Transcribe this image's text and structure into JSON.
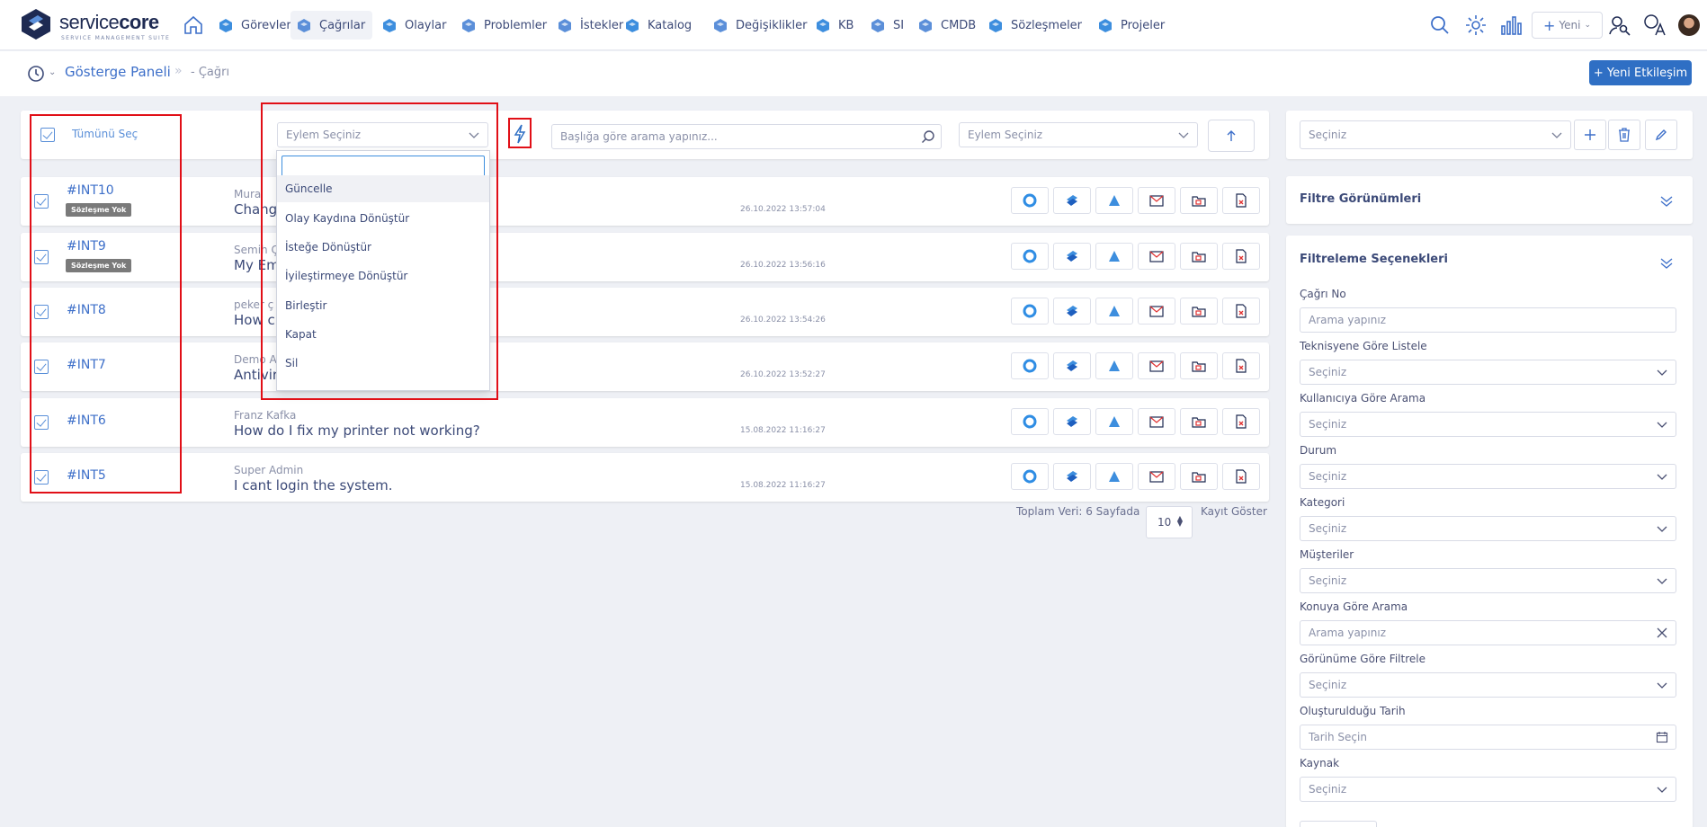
{
  "brand": {
    "name_light": "service",
    "name_bold": "core",
    "tagline": "SERVICE MANAGEMENT SUITE"
  },
  "nav": [
    {
      "label": "Görevler",
      "icon": "tasks-icon"
    },
    {
      "label": "Çağrılar",
      "icon": "calls-icon",
      "active": true
    },
    {
      "label": "Olaylar",
      "icon": "incidents-icon"
    },
    {
      "label": "Problemler",
      "icon": "problems-icon"
    },
    {
      "label": "İstekler",
      "icon": "requests-icon"
    },
    {
      "label": "Katalog",
      "icon": "catalog-icon"
    },
    {
      "label": "Değişiklikler",
      "icon": "changes-icon"
    },
    {
      "label": "KB",
      "icon": "kb-icon"
    },
    {
      "label": "SI",
      "icon": "si-icon"
    },
    {
      "label": "CMDB",
      "icon": "cmdb-icon"
    },
    {
      "label": "Sözleşmeler",
      "icon": "contracts-icon"
    },
    {
      "label": "Projeler",
      "icon": "projects-icon"
    }
  ],
  "topright": {
    "new_label": "Yeni"
  },
  "breadcrumb": {
    "home": "Gösterge Paneli",
    "current": "Çağrı",
    "new_button": "Yeni Etkileşim"
  },
  "toolbar": {
    "select_all": "Tümünü Seç",
    "action_select": "Eylem Seçiniz",
    "search_placeholder": "Başlığa göre arama yapınız...",
    "action_select_2": "Eylem Seçiniz"
  },
  "dropdown": {
    "options": [
      "Güncelle",
      "Olay Kaydına Dönüştür",
      "İsteğe Dönüştür",
      "İyileştirmeye Dönüştür",
      "Birleştir",
      "Kapat",
      "Sil"
    ]
  },
  "rows": [
    {
      "id": "#INT10",
      "badge": "Sözleşme Yok",
      "who": "Mura",
      "title": "Chang",
      "date": "26.10.2022 13:57:04"
    },
    {
      "id": "#INT9",
      "badge": "Sözleşme Yok",
      "who": "Semih Ç",
      "title": "My Em",
      "date": "26.10.2022 13:56:16"
    },
    {
      "id": "#INT8",
      "badge": "",
      "who": "peker ç",
      "title": "How c",
      "date": "26.10.2022 13:54:26"
    },
    {
      "id": "#INT7",
      "badge": "",
      "who": "Demo A",
      "title": "Antivir",
      "date": "26.10.2022 13:52:27"
    },
    {
      "id": "#INT6",
      "badge": "",
      "who": "Franz Kafka",
      "title": "How do I fix my printer not working?",
      "date": "15.08.2022 11:16:27"
    },
    {
      "id": "#INT5",
      "badge": "",
      "who": "Super Admin",
      "title": "I cant login the system.",
      "date": "15.08.2022 11:16:27"
    }
  ],
  "pager": {
    "total": "Toplam Veri: 6 Sayfada",
    "per_page": "10",
    "show": "Kayıt Göster"
  },
  "right_panel": {
    "view_select": "Seçiniz",
    "filter_views": "Filtre Görünümleri",
    "filter_options": "Filtreleme Seçenekleri",
    "fields": [
      {
        "label": "Çağrı No",
        "value": "Arama yapınız",
        "kind": "text"
      },
      {
        "label": "Teknisyene Göre Listele",
        "value": "Seçiniz",
        "kind": "select"
      },
      {
        "label": "Kullanıcıya Göre Arama",
        "value": "Seçiniz",
        "kind": "select"
      },
      {
        "label": "Durum",
        "value": "Seçiniz",
        "kind": "select"
      },
      {
        "label": "Kategori",
        "value": "Seçiniz",
        "kind": "select"
      },
      {
        "label": "Müşteriler",
        "value": "Seçiniz",
        "kind": "select"
      },
      {
        "label": "Konuya Göre Arama",
        "value": "Arama yapınız",
        "kind": "clear"
      },
      {
        "label": "Görünüme Göre Filtrele",
        "value": "Seçiniz",
        "kind": "select"
      },
      {
        "label": "Oluşturulduğu Tarih",
        "value": "Tarih Seçin",
        "kind": "date"
      },
      {
        "label": "Kaynak",
        "value": "Seçiniz",
        "kind": "select"
      }
    ]
  },
  "colors": {
    "accent": "#2f6fc4",
    "link": "#3d6fc9",
    "annotation": "#e10f17",
    "badge": "#7a7a7a"
  }
}
